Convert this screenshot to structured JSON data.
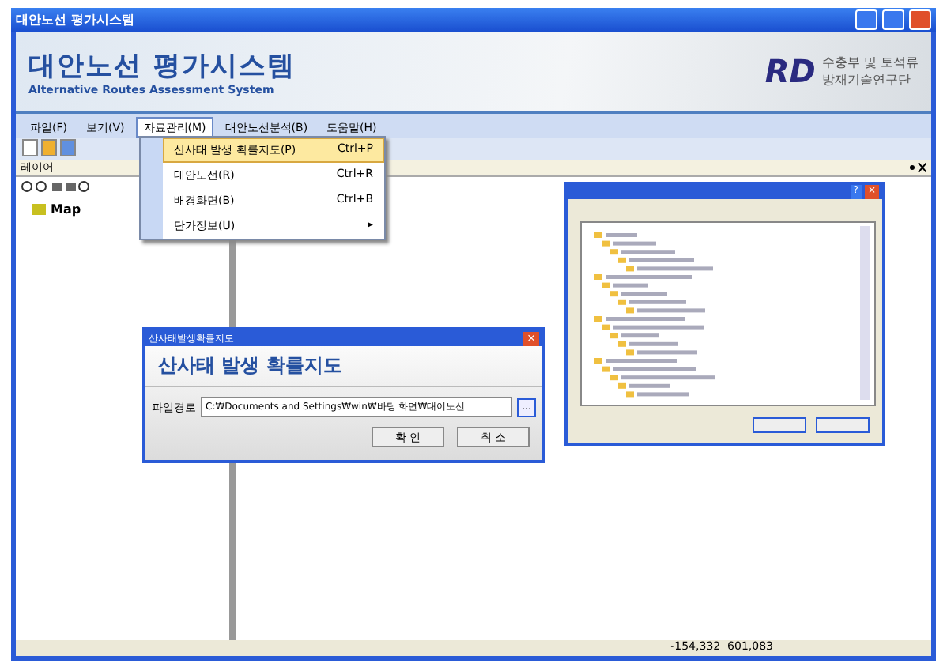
{
  "window": {
    "title": "대안노선 평가시스템"
  },
  "banner": {
    "title": "대안노선 평가시스템",
    "subtitle": "Alternative Routes Assessment System",
    "logo_text": "RD",
    "org_line_1": "수충부 및 토석류",
    "org_line_2": "방재기술연구단"
  },
  "menu": [
    {
      "label": "파일(F)",
      "selected": false
    },
    {
      "label": "보기(V)",
      "selected": false
    },
    {
      "label": "자료관리(M)",
      "selected": true
    },
    {
      "label": "대안노선분석(B)",
      "selected": false
    },
    {
      "label": "도움말(H)",
      "selected": false
    }
  ],
  "dropdown": [
    {
      "label": "산사태 발생 확률지도(P)",
      "shortcut": "Ctrl+P",
      "selected": true
    },
    {
      "label": "대안노선(R)",
      "shortcut": "Ctrl+R",
      "selected": false
    },
    {
      "label": "배경화면(B)",
      "shortcut": "Ctrl+B",
      "selected": false
    },
    {
      "label": "단가정보(U)",
      "arrow": "▸",
      "selected": false
    }
  ],
  "layer_panel": {
    "title": "레이어",
    "tree": [
      {
        "label": "Map"
      }
    ]
  },
  "probability_dialog": {
    "title": "산사태발생확률지도",
    "heading": "산사태 발생 확률지도",
    "field_label": "파일경로",
    "field_value": "C:₩Documents and Settings₩win₩바탕 화면₩대이노선",
    "close": "×",
    "browse": "...",
    "buttons": [
      "확 인",
      "취 소"
    ]
  },
  "folder_dialog": {
    "help": "?",
    "close": "×"
  },
  "status_bar": {
    "coordinates": "-154,332  601,083"
  }
}
